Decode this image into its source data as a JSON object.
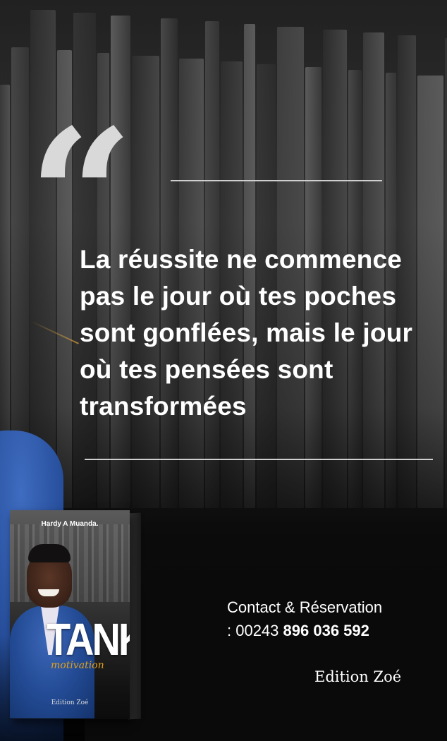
{
  "quote": {
    "mark": "“",
    "text": "La réussite ne commence pas le jour où tes poches sont gonflées, mais le jour où tes pensées sont transformées"
  },
  "book": {
    "author": "Hardy A Muanda.",
    "title": "TANK",
    "subtitle": "motivation",
    "publisher": "Edition Zoé"
  },
  "contact": {
    "label": "Contact & Réservation",
    "prefix": ": 00243",
    "number": "896 036 592"
  },
  "edition": "Edition Zoé",
  "colors": {
    "accent": "#e3a21a",
    "suit": "#274f9c",
    "text": "#ffffff"
  }
}
